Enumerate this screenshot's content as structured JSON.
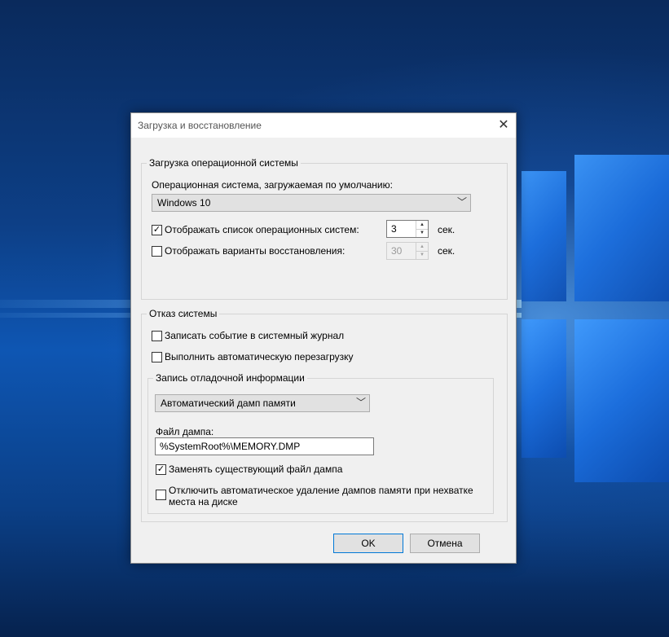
{
  "dialog": {
    "title": "Загрузка и восстановление",
    "close_icon": "close-icon",
    "startup": {
      "legend": "Загрузка операционной системы",
      "default_os_label": "Операционная система, загружаемая по умолчанию:",
      "default_os_value": "Windows 10",
      "show_os_list": {
        "label": "Отображать список операционных систем:",
        "checked": true,
        "value": "3",
        "unit": "сек."
      },
      "show_recovery": {
        "label": "Отображать варианты восстановления:",
        "checked": false,
        "value": "30",
        "unit": "сек."
      }
    },
    "failure": {
      "legend": "Отказ системы",
      "write_event": {
        "label": "Записать событие в системный журнал",
        "checked": false
      },
      "auto_restart": {
        "label": "Выполнить автоматическую перезагрузку",
        "checked": false
      },
      "debug": {
        "legend": "Запись отладочной информации",
        "dump_type": "Автоматический дамп памяти",
        "dump_file_label": "Файл дампа:",
        "dump_file_value": "%SystemRoot%\\MEMORY.DMP",
        "overwrite": {
          "label": "Заменять существующий файл дампа",
          "checked": true
        },
        "disable_autodelete": {
          "label_line1": "Отключить автоматическое удаление дампов памяти при нехватке",
          "label_line2": "места на диске",
          "checked": false
        }
      }
    },
    "buttons": {
      "ok": "OK",
      "cancel": "Отмена"
    }
  }
}
